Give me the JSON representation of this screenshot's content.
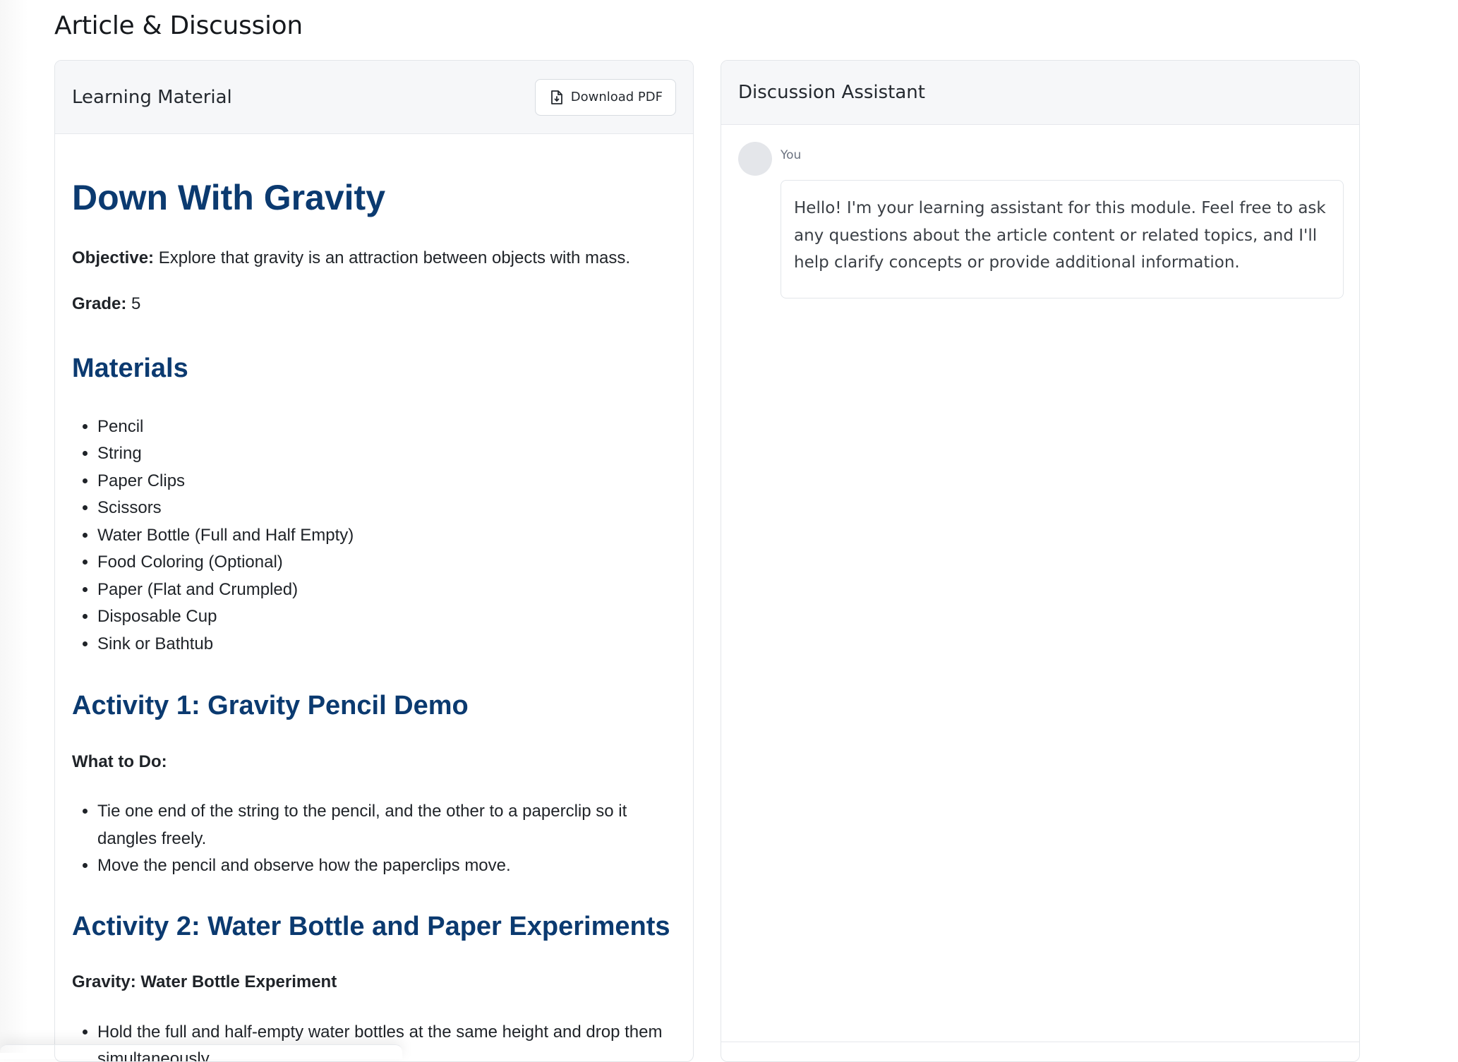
{
  "page": {
    "title": "Article & Discussion"
  },
  "learning_panel": {
    "title": "Learning Material",
    "download_label": "Download PDF",
    "download_icon": "file-download-icon"
  },
  "article": {
    "title": "Down With Gravity",
    "objective_label": "Objective:",
    "objective_text": " Explore that gravity is an attraction between objects with mass.",
    "grade_label": "Grade:",
    "grade_value": " 5",
    "materials_heading": "Materials",
    "materials": [
      "Pencil",
      "String",
      "Paper Clips",
      "Scissors",
      "Water Bottle (Full and Half Empty)",
      "Food Coloring (Optional)",
      "Paper (Flat and Crumpled)",
      "Disposable Cup",
      "Sink or Bathtub"
    ],
    "activity1_heading": "Activity 1: Gravity Pencil Demo",
    "activity1_subheading": "What to Do:",
    "activity1_steps": [
      "Tie one end of the string to the pencil, and the other to a paperclip so it dangles freely.",
      "Move the pencil and observe how the paperclips move."
    ],
    "activity2_heading": "Activity 2: Water Bottle and Paper Experiments",
    "activity2_subheading": "Gravity: Water Bottle Experiment",
    "activity2_steps": [
      "Hold the full and half-empty water bottles at the same height and drop them simultaneously."
    ]
  },
  "discussion_panel": {
    "title": "Discussion Assistant",
    "messages": [
      {
        "sender": "You",
        "text": "Hello! I'm your learning assistant for this module. Feel free to ask any questions about the article content or related topics, and I'll help clarify concepts or provide additional information."
      }
    ]
  },
  "colors": {
    "heading_blue": "#0b3a70",
    "panel_header_bg": "#f6f7f9",
    "border": "#e3e6ea"
  }
}
